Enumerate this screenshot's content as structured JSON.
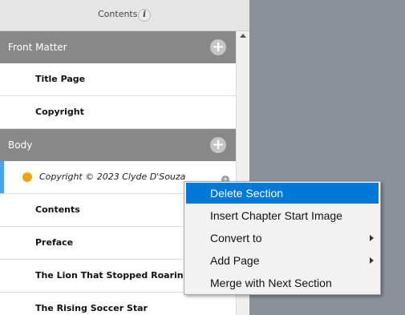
{
  "panel": {
    "title": "Contents",
    "info_icon": "i"
  },
  "sections": [
    {
      "label": "Front Matter",
      "add_icon": "+",
      "items": [
        "Title Page",
        "Copyright"
      ]
    },
    {
      "label": "Body",
      "add_icon": "+",
      "selected_item": "Copyright © 2023 Clyde D'Souza",
      "items": [
        "Contents",
        "Preface",
        "The Lion That Stopped Roaring",
        "The Rising Soccer Star"
      ]
    }
  ],
  "context_menu": {
    "items": [
      {
        "label": "Delete Section",
        "active": true,
        "submenu": false
      },
      {
        "label": "Insert Chapter Start Image",
        "active": false,
        "submenu": false
      },
      {
        "label": "Convert to",
        "active": false,
        "submenu": true
      },
      {
        "label": "Add Page",
        "active": false,
        "submenu": true
      },
      {
        "label": "Merge with Next Section",
        "active": false,
        "submenu": false
      }
    ]
  },
  "colors": {
    "selection_bar": "#4aa3e8",
    "status_dot": "#f0a30a",
    "menu_highlight": "#0078d7"
  }
}
